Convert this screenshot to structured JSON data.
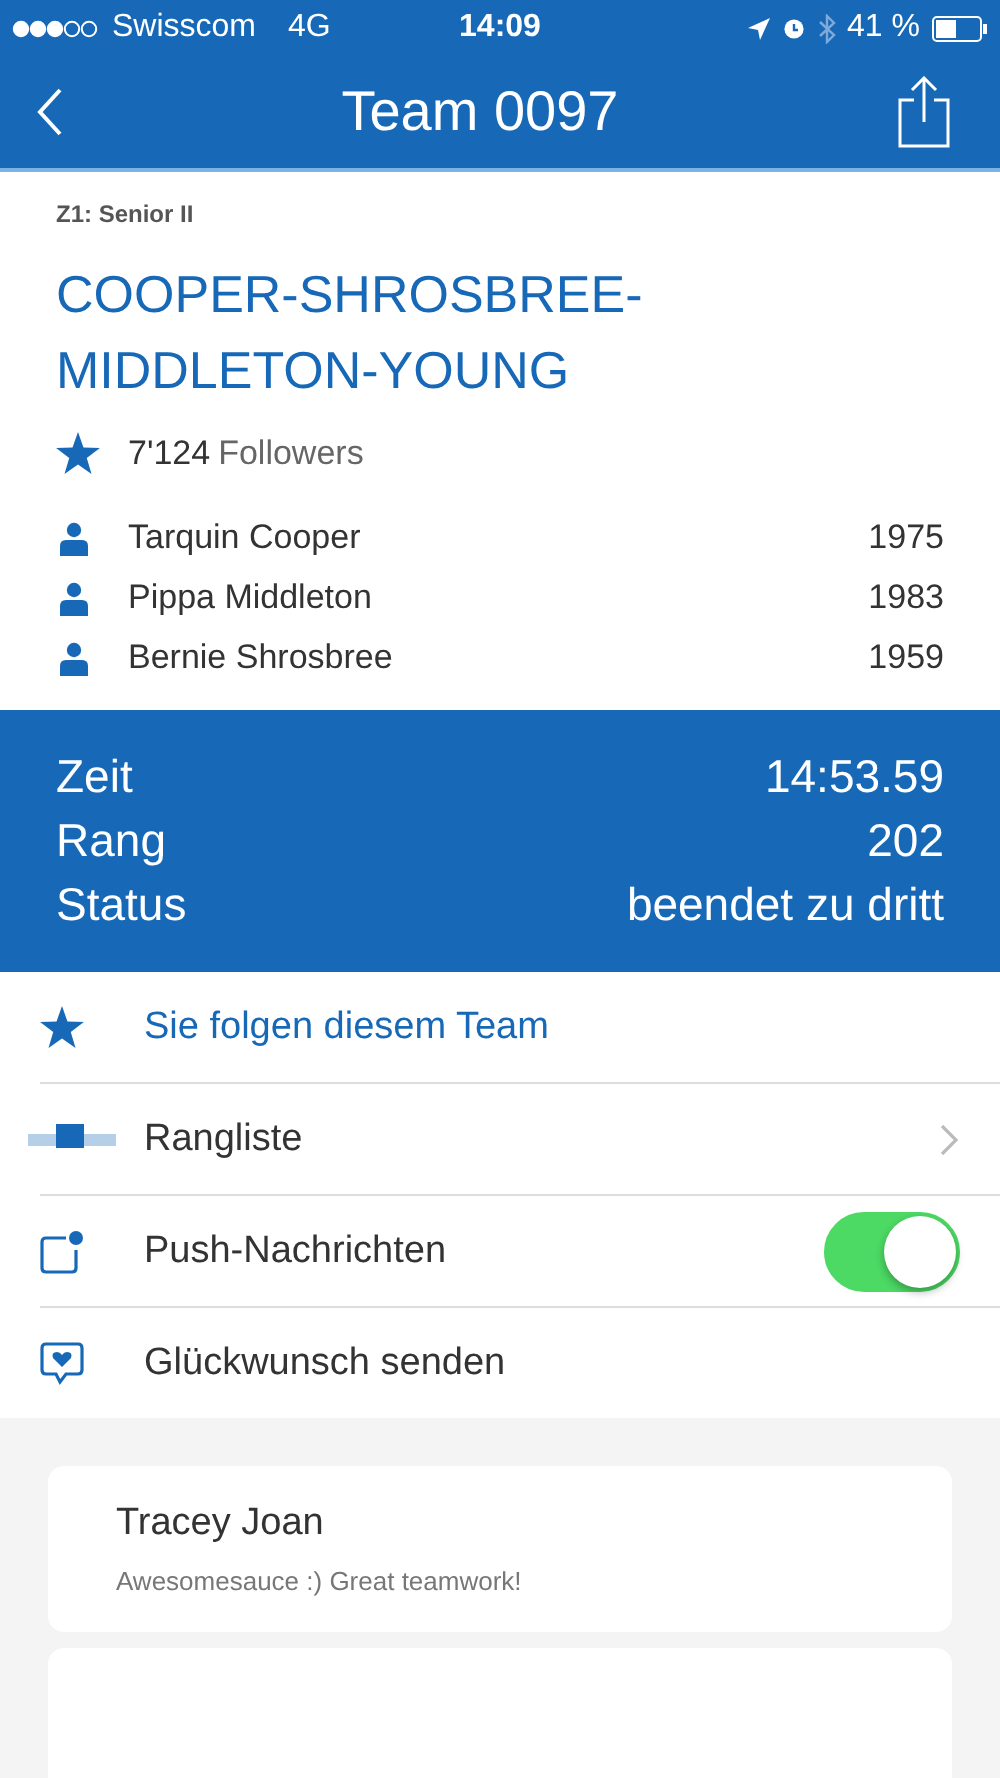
{
  "status_bar": {
    "carrier": "Swisscom",
    "network": "4G",
    "time": "14:09",
    "battery": "41 %"
  },
  "nav": {
    "title": "Team 0097"
  },
  "team": {
    "category": "Z1: Senior II",
    "name": "COOPER-SHROSBREE-MIDDLETON-YOUNG",
    "followers_count": "7'124",
    "followers_label": "Followers"
  },
  "members": [
    {
      "name": "Tarquin Cooper",
      "year": "1975"
    },
    {
      "name": "Pippa Middleton",
      "year": "1983"
    },
    {
      "name": "Bernie Shrosbree",
      "year": "1959"
    }
  ],
  "results": [
    {
      "label": "Zeit",
      "value": "14:53.59"
    },
    {
      "label": "Rang",
      "value": "202"
    },
    {
      "label": "Status",
      "value": "beendet zu dritt"
    }
  ],
  "actions": [
    {
      "kind": "follow",
      "label": "Sie folgen diesem Team"
    },
    {
      "kind": "ranking",
      "label": "Rangliste"
    },
    {
      "kind": "push",
      "label": "Push-Nachrichten",
      "on": true
    },
    {
      "kind": "congrats",
      "label": "Glückwunsch senden"
    }
  ],
  "messages": [
    {
      "kind": "message",
      "name": "Tracey Joan",
      "text": "Awesomesauce :) Great teamwork!"
    },
    {
      "kind": "cut"
    }
  ]
}
